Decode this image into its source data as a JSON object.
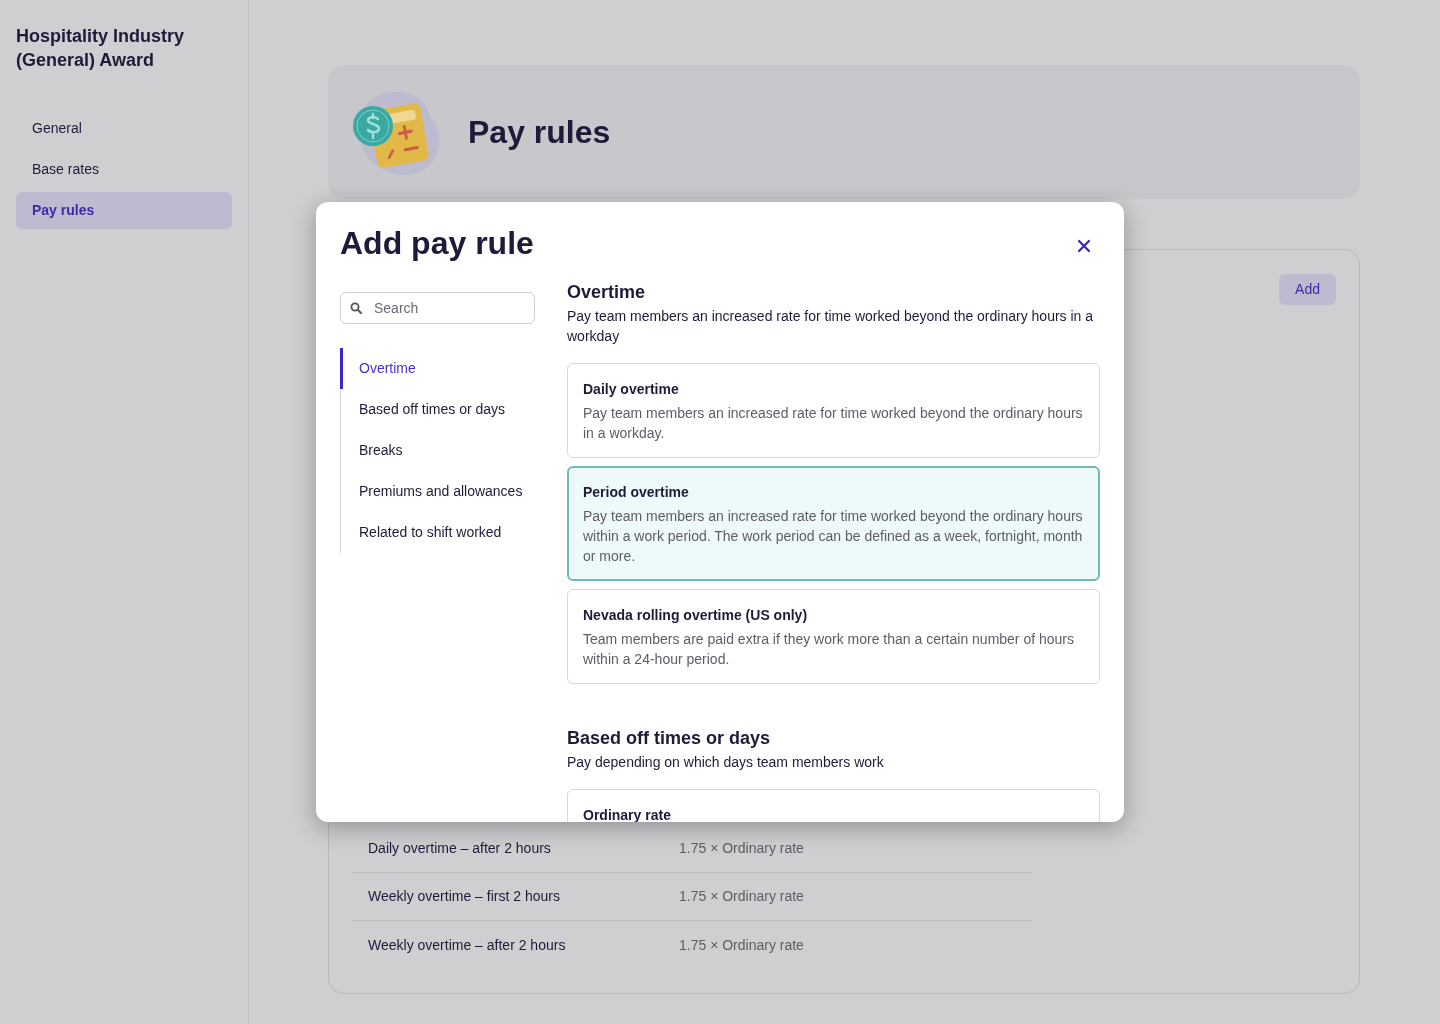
{
  "sidebar": {
    "title": "Hospitality Industry (General) Award",
    "items": [
      {
        "label": "General",
        "selected": false
      },
      {
        "label": "Base rates",
        "selected": false
      },
      {
        "label": "Pay rules",
        "selected": true
      }
    ]
  },
  "page": {
    "title": "Pay rules",
    "add_button": "Add",
    "rows": [
      {
        "name": "Daily overtime – after 2 hours",
        "rate": "1.75 × Ordinary rate"
      },
      {
        "name": "Weekly overtime – first 2 hours",
        "rate": "1.75 × Ordinary rate"
      },
      {
        "name": "Weekly overtime – after 2 hours",
        "rate": "1.75 × Ordinary rate"
      }
    ]
  },
  "modal": {
    "title": "Add pay rule",
    "search": {
      "placeholder": "Search"
    },
    "categories": [
      {
        "label": "Overtime",
        "selected": true
      },
      {
        "label": "Based off times or days",
        "selected": false
      },
      {
        "label": "Breaks",
        "selected": false
      },
      {
        "label": "Premiums and allowances",
        "selected": false
      },
      {
        "label": "Related to shift worked",
        "selected": false
      }
    ],
    "sections": [
      {
        "title": "Overtime",
        "description": "Pay team members an increased rate for time worked beyond the ordinary hours in a workday",
        "options": [
          {
            "title": "Daily overtime",
            "description": "Pay team members an increased rate for time worked beyond the ordinary hours in a workday.",
            "selected": false
          },
          {
            "title": "Period overtime",
            "description": "Pay team members an increased rate for time worked beyond the ordinary hours within a work period. The work period can be defined as a week, fortnight, month or more.",
            "selected": true
          },
          {
            "title": "Nevada rolling overtime (US only)",
            "description": "Team members are paid extra if they work more than a certain number of hours within a 24-hour period.",
            "selected": false
          }
        ]
      },
      {
        "title": "Based off times or days",
        "description": "Pay depending on which days team members work",
        "options": [
          {
            "title": "Ordinary rate",
            "selected": false
          }
        ]
      }
    ]
  }
}
